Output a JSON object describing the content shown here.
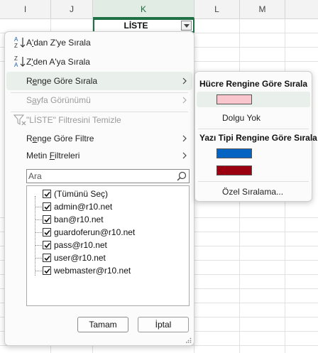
{
  "sheet": {
    "columns": [
      {
        "label": "I",
        "selected": false
      },
      {
        "label": "J",
        "selected": false
      },
      {
        "label": "K",
        "selected": true
      },
      {
        "label": "L",
        "selected": false
      },
      {
        "label": "M",
        "selected": false
      }
    ],
    "header_cell": "LİSTE",
    "accent_color": "#1e7145"
  },
  "menu": {
    "sort_az": {
      "pre": "A",
      "underline": "'",
      "post": "dan Z'ye Sırala",
      "icon": "sort-az-icon"
    },
    "sort_za": {
      "pre": "Z",
      "underline": "'",
      "post": "den A'ya Sırala",
      "icon": "sort-za-icon"
    },
    "sort_by_color": {
      "pre": "R",
      "underline": "e",
      "post": "nge Göre Sırala"
    },
    "sheet_view": {
      "pre": "S",
      "underline": "a",
      "post": "yfa Görünümü"
    },
    "clear_filter": {
      "label": "\"LİSTE\" Filtresini Temizle",
      "icon": "clear-filter-icon"
    },
    "filter_by_color": {
      "pre": "R",
      "underline": "e",
      "post": "nge Göre Filtre"
    },
    "text_filters": {
      "pre": "Metin ",
      "underline": "F",
      "post": "iltreleri"
    }
  },
  "search": {
    "placeholder": "Ara",
    "value": ""
  },
  "list": {
    "items": [
      {
        "label": "(Tümünü Seç)",
        "checked": true
      },
      {
        "label": "admin@r10.net",
        "checked": true
      },
      {
        "label": "ban@r10.net",
        "checked": true
      },
      {
        "label": "guardoferun@r10.net",
        "checked": true
      },
      {
        "label": "pass@r10.net",
        "checked": true
      },
      {
        "label": "user@r10.net",
        "checked": true
      },
      {
        "label": "webmaster@r10.net",
        "checked": true
      }
    ]
  },
  "buttons": {
    "ok": "Tamam",
    "cancel": "İptal"
  },
  "submenu": {
    "cell_color_heading": "Hücre Rengine Göre Sırala",
    "cell_colors": [
      "#f8c6cc"
    ],
    "no_fill": "Dolgu Yok",
    "font_color_heading": "Yazı Tipi Rengine Göre Sırala",
    "font_colors": [
      "#0563c1",
      "#9b0010"
    ],
    "custom_sort": "Özel Sıralama..."
  }
}
